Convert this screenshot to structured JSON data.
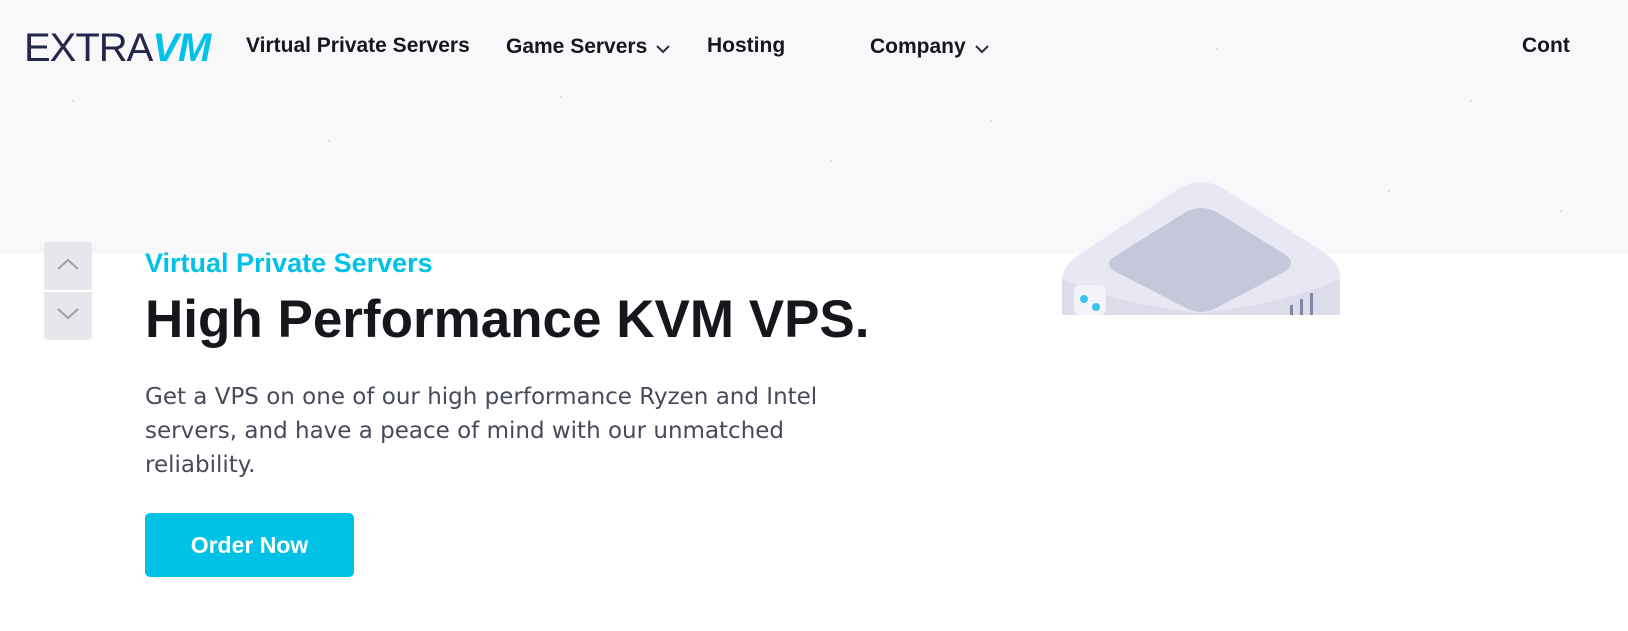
{
  "brand": {
    "logo_left": "EXTRA",
    "logo_right": "VM",
    "colors": {
      "dark": "#24264a",
      "accent": "#00c2e6"
    }
  },
  "nav": {
    "items": [
      {
        "label": "Virtual Private Servers",
        "has_dropdown": false
      },
      {
        "label": "Game Servers",
        "has_dropdown": true
      },
      {
        "label": "Hosting",
        "has_dropdown": false
      },
      {
        "label": "Company",
        "has_dropdown": true
      },
      {
        "label": "Cont",
        "has_dropdown": false
      }
    ]
  },
  "slider": {
    "prev_icon": "chevron-up-icon",
    "next_icon": "chevron-down-icon"
  },
  "hero": {
    "eyebrow": "Virtual Private Servers",
    "title": "High Performance KVM VPS.",
    "description": "Get a VPS on one of our high performance Ryzen and Intel servers, and have a peace of mind with our unmatched reliability.",
    "cta_label": "Order Now",
    "illustration_icon": "server-icon"
  }
}
